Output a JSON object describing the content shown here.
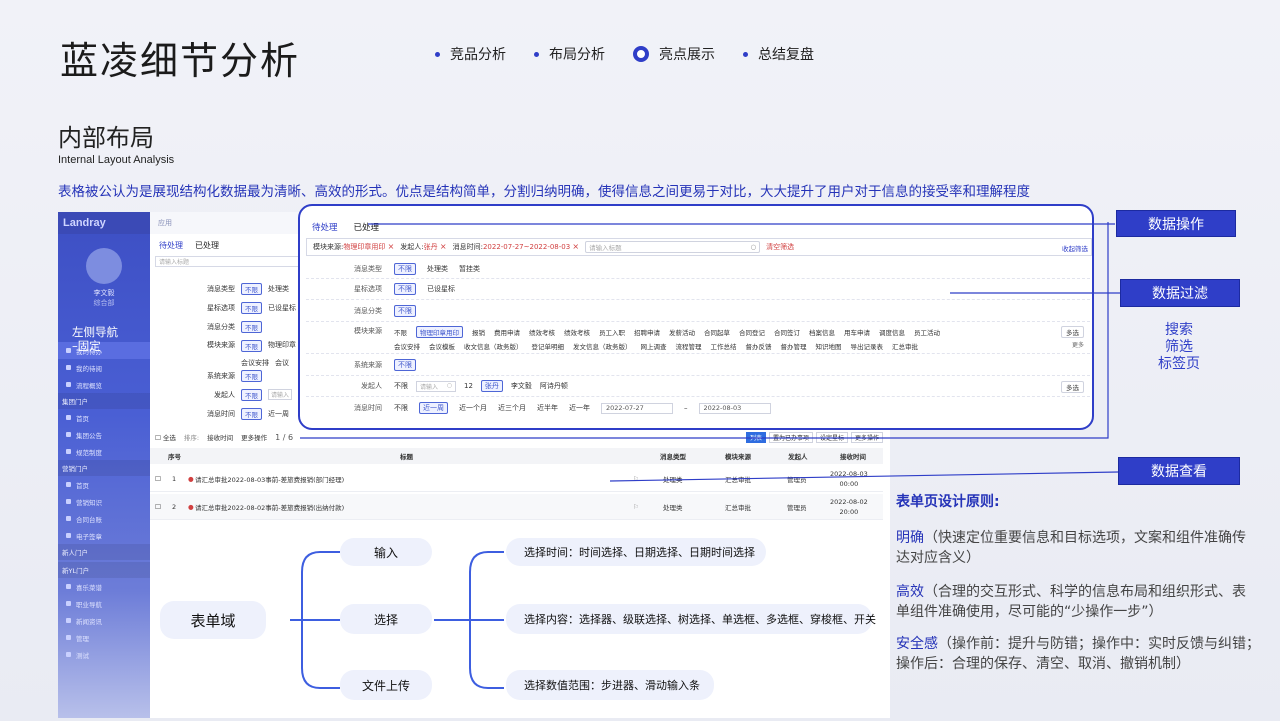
{
  "header": {
    "title": "蓝凌细节分析",
    "nav": [
      {
        "label": "竞品分析",
        "active": false
      },
      {
        "label": "布局分析",
        "active": false
      },
      {
        "label": "亮点展示",
        "active": true
      },
      {
        "label": "总结复盘",
        "active": false
      }
    ]
  },
  "section": {
    "title": "内部布局",
    "subtitle": "Internal Layout Analysis",
    "intro": "表格被公认为是展现结构化数据最为清晰、高效的形式。优点是结构简单，分割归纳明确，使得信息之间更易于对比，大大提升了用户对于信息的接受率和理解程度"
  },
  "sidebar": {
    "brand": "Landray",
    "user": "李文毅",
    "user_sub": "综合部",
    "label_line1": "左侧导航",
    "label_line2": "–固定",
    "items": [
      "我的待办",
      "我的待阅",
      "流程概览"
    ],
    "groups": [
      {
        "name": "集团门户",
        "items": [
          "首页",
          "集团公告",
          "规范制度"
        ]
      },
      {
        "name": "营销门户",
        "items": [
          "首页",
          "营销知识",
          "合同台账",
          "电子签章"
        ]
      },
      {
        "name": "新人门户",
        "items": []
      },
      {
        "name": "新YL门户",
        "items": [
          "喜乐菜谱",
          "职业导航",
          "新闻资讯",
          "管理",
          "测试"
        ]
      }
    ]
  },
  "topbar": {
    "app": "应用"
  },
  "bgform": {
    "tabs": [
      "待处理",
      "已处理"
    ],
    "search": "请输入标题",
    "rows": [
      {
        "label": "消息类型",
        "opts": [
          "不限",
          "处理类"
        ]
      },
      {
        "label": "星标选项",
        "opts": [
          "不限",
          "已设星标"
        ]
      },
      {
        "label": "消息分类",
        "opts": [
          "不限"
        ]
      },
      {
        "label": "模块来源",
        "opts": [
          "不限",
          "物理印章"
        ]
      },
      {
        "label": "系统来源",
        "opts": [
          "不限"
        ]
      },
      {
        "label": "发起人",
        "opts": [
          "不限"
        ]
      },
      {
        "label": "消息时间",
        "opts": [
          "不限",
          "近一周"
        ]
      }
    ],
    "extra": [
      "会议安排",
      "会议"
    ],
    "search_person": "请输入"
  },
  "panel": {
    "tabs": [
      "待处理",
      "已处理"
    ],
    "chips": [
      {
        "k": "模块来源:",
        "v": "物理印章用印"
      },
      {
        "k": "发起人:",
        "v": "张丹"
      },
      {
        "k": "消息时间:",
        "v": "2022-07-27~2022-08-03"
      }
    ],
    "search_placeholder": "请输入标题",
    "clear": "清空筛选",
    "collapse": "收起筛选",
    "row_msgtype": {
      "label": "消息类型",
      "opts": [
        "不限",
        "处理类",
        "暂挂类"
      ]
    },
    "row_star": {
      "label": "星标选项",
      "opts": [
        "不限",
        "已设星标"
      ]
    },
    "row_cat": {
      "label": "消息分类",
      "opts": [
        "不限"
      ]
    },
    "row_module": {
      "label": "模块来源",
      "line1": [
        "不限",
        "物理印章用印",
        "报销",
        "费用申请",
        "绩效考核",
        "绩效考核",
        "员工入职",
        "招聘申请",
        "发薪活动",
        "合同起草",
        "合同登记",
        "合同签订",
        "档案信息",
        "用车申请",
        "调度信息",
        "员工活动"
      ],
      "line2": [
        "会议安排",
        "会议模板",
        "收文信息（政务版）",
        "登记单明细",
        "发文信息（政务版）",
        "网上调查",
        "流程管理",
        "工作总结",
        "督办反馈",
        "督办管理",
        "知识地图",
        "导出记录表",
        "汇总审批"
      ],
      "more": "多选",
      "more2": "更多"
    },
    "row_sys": {
      "label": "系统来源",
      "opts": [
        "不限"
      ]
    },
    "row_person": {
      "label": "发起人",
      "opts": [
        "不限"
      ],
      "search": "请输入",
      "count": "12",
      "sel": "张丹",
      "p2": "李文毅",
      "p3": "阿诗丹顿",
      "more": "多选"
    },
    "row_time": {
      "label": "消息时间",
      "opts": [
        "不限",
        "近一周",
        "近一个月",
        "近三个月",
        "近半年",
        "近一年"
      ],
      "from": "2022-07-27",
      "to": "2022-08-03",
      "sep": "–"
    }
  },
  "listbar": {
    "select_all": "全选",
    "sort": "排序:",
    "sort_by": "接收时间",
    "more_ops": "更多操作",
    "page": "1",
    "pages": "/ 6",
    "views": [
      "列表",
      "置为已办事项",
      "设定星标",
      "更多操作"
    ]
  },
  "table": {
    "headers": [
      "序号",
      "标题",
      "消息类型",
      "模块来源",
      "发起人",
      "接收时间"
    ],
    "rows": [
      {
        "no": "1",
        "title": "请汇总审批2022-08-03事前-差旅费报销(部门经理)",
        "type": "处理类",
        "module": "汇总审批",
        "person": "管理员",
        "date": "2022-08-03",
        "time": "00:00"
      },
      {
        "no": "2",
        "title": "请汇总审批2022-08-02事前-差旅费报销(出纳付款)",
        "type": "处理类",
        "module": "汇总审批",
        "person": "管理员",
        "date": "2022-08-02",
        "time": "20:00"
      }
    ]
  },
  "diagram": {
    "root": "表单域",
    "mid": [
      "输入",
      "选择",
      "文件上传"
    ],
    "leaves": [
      "选择时间：时间选择、日期选择、日期时间选择",
      "选择内容：选择器、级联选择、树选择、单选框、多选框、穿梭框、开关",
      "选择数值范围：步进器、滑动输入条"
    ]
  },
  "callouts": {
    "op": "数据操作",
    "filter": "数据过滤",
    "view": "数据查看",
    "side": [
      "搜索",
      "筛选",
      "标签页"
    ]
  },
  "principles": {
    "title": "表单页设计原则:",
    "items": [
      {
        "k": "明确",
        "v": "（快速定位重要信息和目标选项，文案和组件准确传达对应含义）"
      },
      {
        "k": "高效",
        "v": "（合理的交互形式、科学的信息布局和组织形式、表单组件准确使用，尽可能的“少操作一步”）"
      },
      {
        "k": "安全感",
        "v": "（操作前：提升与防错；操作中：实时反馈与纠错；操作后：合理的保存、清空、取消、撤销机制）"
      }
    ]
  },
  "colors": {
    "accent": "#2f3ec8",
    "red": "#d14040"
  }
}
